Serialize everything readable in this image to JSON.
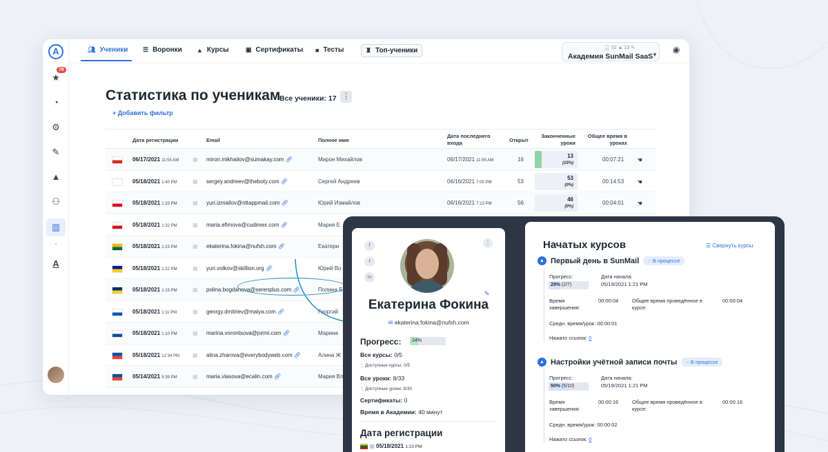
{
  "nav": {
    "tabs": [
      {
        "label": "Ученики",
        "icon": "users-icon",
        "active": true
      },
      {
        "label": "Воронки",
        "icon": "funnel-icon"
      },
      {
        "label": "Курсы",
        "icon": "graduation-cap-icon"
      },
      {
        "label": "Сертификаты",
        "icon": "certificate-icon"
      },
      {
        "label": "Тесты",
        "icon": "quiz-icon"
      },
      {
        "label": "Топ-ученики",
        "icon": "trophy-icon"
      }
    ],
    "org": {
      "stat_users": "52",
      "stat_grads": "13",
      "name": "Академия SunMail SaaS"
    },
    "sidebar_badge": "78"
  },
  "page": {
    "title": "Статистика по ученикам",
    "count": "Все ученики: 17",
    "add_filter": "+ Добавить фильтр"
  },
  "table": {
    "headers": [
      "Дата регистрации",
      "Email",
      "Полное имя",
      "Дата последнего входа",
      "Открыт",
      "Законченные уроки",
      "Общее время в уроках"
    ],
    "rows": [
      {
        "flag": [
          "#ffffff",
          "#d52b1e"
        ],
        "date": "06/17/2021",
        "time": "11:55 AM",
        "email": "miron.mikhailov@sumakay.com",
        "name": "Мирон Михайлов",
        "last_date": "06/17/2021",
        "last_time": "11:55 AM",
        "opened": "16",
        "lessons": "13",
        "lessons_pct": "(15%)",
        "lessons_fill": 0.15,
        "total": "00:07:21"
      },
      {
        "flag": [
          "#ffffff",
          "#ffffff"
        ],
        "date": "05/18/2021",
        "time": "1:40 PM",
        "email": "sergey.andreev@theboty.com",
        "name": "Сергей Андреев",
        "last_date": "06/16/2021",
        "last_time": "7:00 PM",
        "opened": "53",
        "lessons": "53",
        "lessons_pct": "(0%)",
        "lessons_fill": 0,
        "total": "00:14:53"
      },
      {
        "flag": [
          "#ffffff",
          "#d7141a"
        ],
        "date": "05/18/2021",
        "time": "1:33 PM",
        "email": "yuri.izmailov@ottappmail.com",
        "name": "Юрий Измайлов",
        "last_date": "06/16/2021",
        "last_time": "7:13 PM",
        "opened": "56",
        "lessons": "46",
        "lessons_pct": "(0%)",
        "lessons_fill": 0,
        "total": "00:04:01"
      },
      {
        "flag": [
          "#ffffff",
          "#d7141a"
        ],
        "date": "05/18/2021",
        "time": "1:32 PM",
        "email": "maria.efimova@cudimex.com",
        "name": "Мария Е"
      },
      {
        "flag": [
          "#fdb913",
          "#006a44"
        ],
        "date": "05/18/2021",
        "time": "1:23 PM",
        "email": "ekaterina.fokina@nufsh.com",
        "name": "Екатери"
      },
      {
        "flag": [
          "#0018a8",
          "#fcd116"
        ],
        "date": "05/18/2021",
        "time": "1:22 PM",
        "email": "yuri.volkov@skillion.org",
        "name": "Юрий Во"
      },
      {
        "flag": [
          "#002b7f",
          "#fcd116"
        ],
        "date": "05/18/2021",
        "time": "1:15 PM",
        "email": "polina.bogdanova@serenplus.com",
        "name": "Полина Б"
      },
      {
        "flag": [
          "#ffffff",
          "#0057b8"
        ],
        "date": "05/18/2021",
        "time": "1:11 PM",
        "email": "georgy.dmitriev@malya.com",
        "name": "Георгий"
      },
      {
        "flag": [
          "#ffffff",
          "#0b4ea2"
        ],
        "date": "05/18/2021",
        "time": "1:10 PM",
        "email": "marina.vorontsova@jormi.com",
        "name": "Марина"
      },
      {
        "flag": [
          "#0055a4",
          "#ef4135"
        ],
        "date": "05/18/2021",
        "time": "12:34 PM",
        "email": "alina.zharova@everybodyweb.com",
        "name": "Алина Ж"
      },
      {
        "flag": [
          "#0055a4",
          "#ef4135"
        ],
        "date": "05/14/2021",
        "time": "5:39 PM",
        "email": "maria.vlasova@ecalin.com",
        "name": "Мария Вл"
      }
    ]
  },
  "profile": {
    "name": "Екатерина Фокина",
    "email": "ekaterina.fokina@nufsh.com",
    "progress_label": "Прогресс:",
    "progress": "24%",
    "progress_value": 0.24,
    "all_courses_label": "Все курсы:",
    "all_courses": "0/5",
    "available_courses": "Доступные курсы: 0/5",
    "all_lessons_label": "Все уроки:",
    "all_lessons": "8/33",
    "available_lessons": "Доступные уроки: 8/30",
    "certificates_label": "Сертификаты:",
    "certificates": "0",
    "time_label": "Время в Академии:",
    "time": "40 минут",
    "reg_title": "Дата регистрации",
    "reg_date": "05/18/2021",
    "reg_time": "1:23 PM"
  },
  "courses": {
    "title": "Начатых курсов",
    "collapse": "Свернуть курсы",
    "items": [
      {
        "title": "Первый день в SunMail",
        "status": "В процессе",
        "progress_label": "Прогресс:",
        "progress": "29%",
        "progress_detail": "(2/7)",
        "progress_value": 0.29,
        "start_label": "Дата начала:",
        "start": "05/19/2021 1:21 PM",
        "finish_label": "Время завершения:",
        "finish": "00:00:04",
        "total_label": "Общее время проведённое в курсе:",
        "total": "00:00:04",
        "avg_label": "Средн. время/урок:",
        "avg": "00:00:01",
        "links_label": "Нажато ссылок:",
        "links": "0"
      },
      {
        "title": "Настройки учётной записи почты",
        "status": "В процессе",
        "progress_label": "Прогресс:",
        "progress": "50%",
        "progress_detail": "(5/10)",
        "progress_value": 0.5,
        "start_label": "Дата начала:",
        "start": "05/19/2021 1:21 PM",
        "finish_label": "Время завершения:",
        "finish": "00:00:16",
        "total_label": "Общее время проведённое в курсе:",
        "total": "00:00:16",
        "avg_label": "Средн. время/урок:",
        "avg": "00:00:02",
        "links_label": "Нажато ссылок:",
        "links": "0"
      }
    ]
  }
}
